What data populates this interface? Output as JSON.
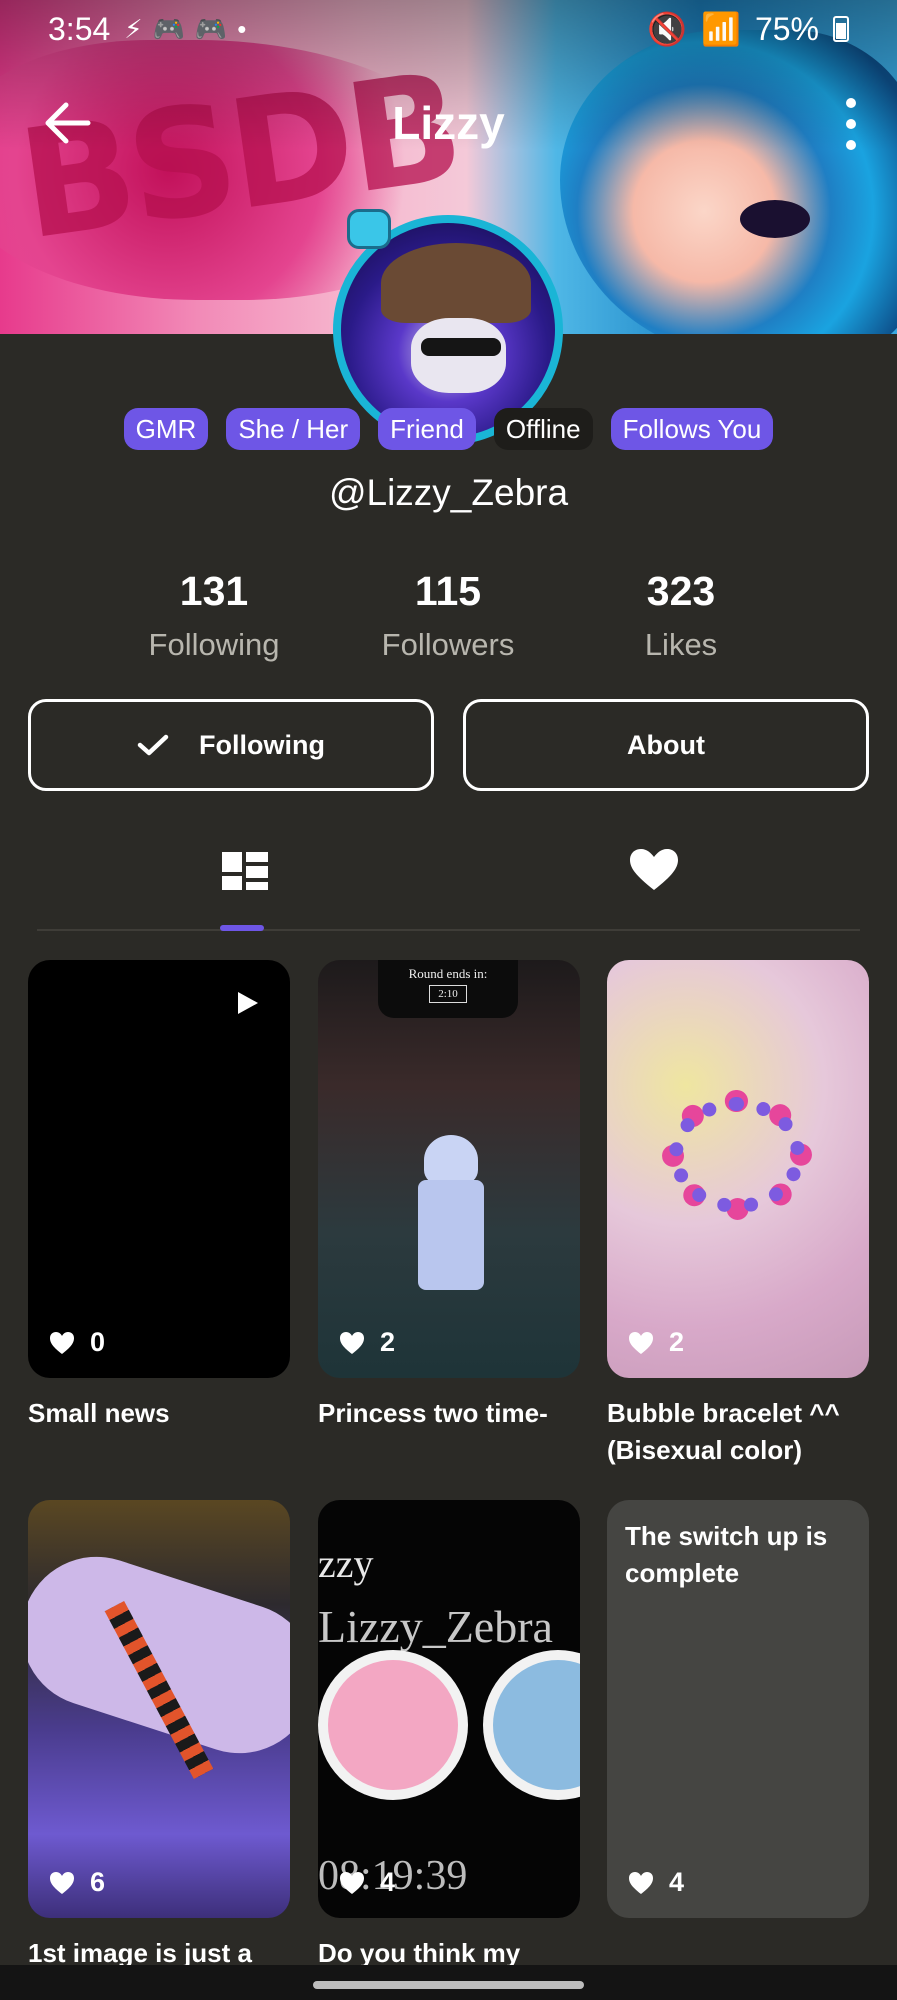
{
  "status_bar": {
    "time": "3:54",
    "battery": "75%",
    "icons": [
      "lightning-icon",
      "discord-icon",
      "discord-icon",
      "dot-icon"
    ],
    "right_icons": [
      "mute-icon",
      "wifi-icon",
      "signal-icon",
      "battery-icon"
    ]
  },
  "header": {
    "title": "Lizzy"
  },
  "profile": {
    "tags": [
      {
        "label": "GMR",
        "color": "#6e56e6"
      },
      {
        "label": "She / Her",
        "color": "#6e56e6"
      },
      {
        "label": "Friend",
        "color": "#6e56e6"
      },
      {
        "label": "Offline",
        "color": "#1e1d1a"
      },
      {
        "label": "Follows You",
        "color": "#6e56e6"
      }
    ],
    "handle": "@Lizzy_Zebra",
    "stats": [
      {
        "value": "131",
        "label": "Following"
      },
      {
        "value": "115",
        "label": "Followers"
      },
      {
        "value": "323",
        "label": "Likes"
      }
    ],
    "buttons": {
      "following": "Following",
      "about": "About"
    }
  },
  "tabs": [
    {
      "icon": "grid-icon",
      "active": true
    },
    {
      "icon": "heart-icon",
      "active": false
    }
  ],
  "posts": [
    {
      "title": "Small news",
      "likes": "0",
      "type": "video"
    },
    {
      "title": "Princess two time-",
      "likes": "2",
      "overlay_top": "Round ends in:",
      "overlay_timer": "2:10"
    },
    {
      "title": "Bubble bracelet ^^ (Bisexual color)",
      "likes": "2"
    },
    {
      "title": "1st image is just a",
      "likes": "6"
    },
    {
      "title": "Do you think my",
      "likes": "4",
      "image_text_1": "zzy",
      "image_text_2": "Lizzy_Zebra",
      "image_text_3": "08:19:39"
    },
    {
      "title": "",
      "likes": "4",
      "text_post": "The switch up is complete"
    }
  ],
  "colors": {
    "accent": "#6e56e6",
    "background": "#2b2a26"
  }
}
